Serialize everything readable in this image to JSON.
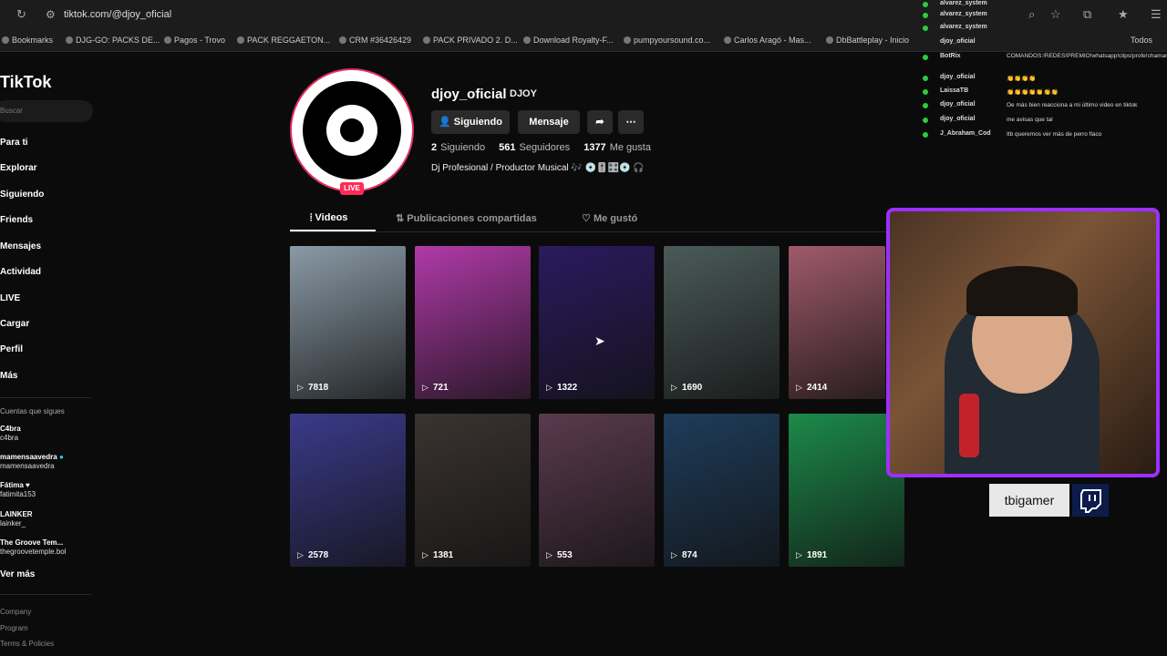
{
  "browser": {
    "url": "tiktok.com/@djoy_oficial",
    "bookmarks": [
      "Bookmarks",
      "DJG-GO: PACKS DE...",
      "Pagos - Trovo",
      "PACK REGGAETON...",
      "CRM #36426429",
      "PACK PRIVADO 2. D...",
      "Download Royalty-F...",
      "pumpyoursound.co...",
      "Carlos Aragó - Mas...",
      "DbBattleplay - Inicio"
    ],
    "bookmarks_end": "Todos"
  },
  "sidebar": {
    "logo": "TikTok",
    "search_placeholder": "Buscar",
    "nav": [
      "Para ti",
      "Explorar",
      "Siguiendo",
      "Friends",
      "Mensajes",
      "Actividad",
      "LIVE",
      "Cargar",
      "Perfil",
      "Más"
    ],
    "following_title": "Cuentas que sigues",
    "following": [
      {
        "name": "C4bra",
        "handle": "c4bra"
      },
      {
        "name": "mamensaavedra",
        "handle": "mamensaavedra"
      },
      {
        "name": "Fátima ♥",
        "handle": "fatimita153"
      },
      {
        "name": "LAINKER",
        "handle": "lainker_"
      },
      {
        "name": "The Groove Tem...",
        "handle": "thegroovetemple.bol"
      }
    ],
    "see_more": "Ver más",
    "footer": [
      "Company",
      "Program",
      "Terms & Policies"
    ]
  },
  "profile": {
    "username": "djoy_oficial",
    "display_name": "DJOY",
    "live_badge": "LIVE",
    "following_button": "Siguiendo",
    "message_button": "Mensaje",
    "stats": [
      {
        "value": "2",
        "label": "Siguiendo"
      },
      {
        "value": "561",
        "label": "Seguidores"
      },
      {
        "value": "1377",
        "label": "Me gusta"
      }
    ],
    "bio": "Dj Profesional / Productor Musical 🎶 💿🎚️🎛️💿 🎧"
  },
  "tabs": [
    "Videos",
    "Publicaciones compartidas",
    "Me gustó"
  ],
  "videos": [
    {
      "views": "7818",
      "color": "#8a9aa6"
    },
    {
      "views": "721",
      "color": "#b03aa8"
    },
    {
      "views": "1322",
      "color": "#2a1a5e"
    },
    {
      "views": "1690",
      "color": "#4a5a58"
    },
    {
      "views": "2414",
      "color": "#a05a6a"
    },
    {
      "views": "2578",
      "color": "#3a3a8a"
    },
    {
      "views": "1381",
      "color": "#3a3330"
    },
    {
      "views": "553",
      "color": "#5a3a4e"
    },
    {
      "views": "874",
      "color": "#1e3c5a"
    },
    {
      "views": "1891",
      "color": "#1c8a4a"
    }
  ],
  "chat": [
    {
      "user": "alvarez_system",
      "msg": ""
    },
    {
      "user": "alvarez_system",
      "msg": ""
    },
    {
      "user": "alvarez_system",
      "msg": ""
    },
    {
      "user": "djoy_oficial",
      "msg": "COMANDOS:!REDES!PREMIO!whatsapp!clips!profe!chaman"
    },
    {
      "user": "BotRix",
      "msg": ""
    },
    {
      "user": "djoy_oficial",
      "msg": "👏👏👏👏"
    },
    {
      "user": "LaissaTB",
      "msg": "👏👏👏👏👏👏👏"
    },
    {
      "user": "djoy_oficial",
      "msg": "Oe más bien reacciona a mi último video en tiktok"
    },
    {
      "user": "djoy_oficial",
      "msg": "me avisas que tal"
    },
    {
      "user": "J_Abraham_Cod",
      "msg": "Itb queremos ver más de perro flaco"
    }
  ],
  "streamer": {
    "name": "tbigamer"
  },
  "colors": {
    "accent": "#fe2c55",
    "twitch": "#9b30ff"
  }
}
